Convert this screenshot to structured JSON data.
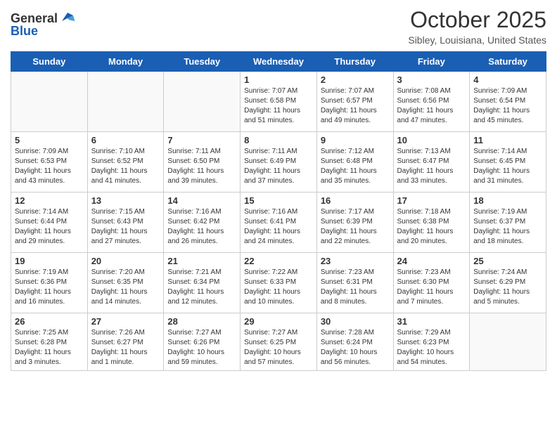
{
  "header": {
    "logo_general": "General",
    "logo_blue": "Blue",
    "month_title": "October 2025",
    "location": "Sibley, Louisiana, United States"
  },
  "days_of_week": [
    "Sunday",
    "Monday",
    "Tuesday",
    "Wednesday",
    "Thursday",
    "Friday",
    "Saturday"
  ],
  "weeks": [
    [
      {
        "day": "",
        "info": ""
      },
      {
        "day": "",
        "info": ""
      },
      {
        "day": "",
        "info": ""
      },
      {
        "day": "1",
        "info": "Sunrise: 7:07 AM\nSunset: 6:58 PM\nDaylight: 11 hours and 51 minutes."
      },
      {
        "day": "2",
        "info": "Sunrise: 7:07 AM\nSunset: 6:57 PM\nDaylight: 11 hours and 49 minutes."
      },
      {
        "day": "3",
        "info": "Sunrise: 7:08 AM\nSunset: 6:56 PM\nDaylight: 11 hours and 47 minutes."
      },
      {
        "day": "4",
        "info": "Sunrise: 7:09 AM\nSunset: 6:54 PM\nDaylight: 11 hours and 45 minutes."
      }
    ],
    [
      {
        "day": "5",
        "info": "Sunrise: 7:09 AM\nSunset: 6:53 PM\nDaylight: 11 hours and 43 minutes."
      },
      {
        "day": "6",
        "info": "Sunrise: 7:10 AM\nSunset: 6:52 PM\nDaylight: 11 hours and 41 minutes."
      },
      {
        "day": "7",
        "info": "Sunrise: 7:11 AM\nSunset: 6:50 PM\nDaylight: 11 hours and 39 minutes."
      },
      {
        "day": "8",
        "info": "Sunrise: 7:11 AM\nSunset: 6:49 PM\nDaylight: 11 hours and 37 minutes."
      },
      {
        "day": "9",
        "info": "Sunrise: 7:12 AM\nSunset: 6:48 PM\nDaylight: 11 hours and 35 minutes."
      },
      {
        "day": "10",
        "info": "Sunrise: 7:13 AM\nSunset: 6:47 PM\nDaylight: 11 hours and 33 minutes."
      },
      {
        "day": "11",
        "info": "Sunrise: 7:14 AM\nSunset: 6:45 PM\nDaylight: 11 hours and 31 minutes."
      }
    ],
    [
      {
        "day": "12",
        "info": "Sunrise: 7:14 AM\nSunset: 6:44 PM\nDaylight: 11 hours and 29 minutes."
      },
      {
        "day": "13",
        "info": "Sunrise: 7:15 AM\nSunset: 6:43 PM\nDaylight: 11 hours and 27 minutes."
      },
      {
        "day": "14",
        "info": "Sunrise: 7:16 AM\nSunset: 6:42 PM\nDaylight: 11 hours and 26 minutes."
      },
      {
        "day": "15",
        "info": "Sunrise: 7:16 AM\nSunset: 6:41 PM\nDaylight: 11 hours and 24 minutes."
      },
      {
        "day": "16",
        "info": "Sunrise: 7:17 AM\nSunset: 6:39 PM\nDaylight: 11 hours and 22 minutes."
      },
      {
        "day": "17",
        "info": "Sunrise: 7:18 AM\nSunset: 6:38 PM\nDaylight: 11 hours and 20 minutes."
      },
      {
        "day": "18",
        "info": "Sunrise: 7:19 AM\nSunset: 6:37 PM\nDaylight: 11 hours and 18 minutes."
      }
    ],
    [
      {
        "day": "19",
        "info": "Sunrise: 7:19 AM\nSunset: 6:36 PM\nDaylight: 11 hours and 16 minutes."
      },
      {
        "day": "20",
        "info": "Sunrise: 7:20 AM\nSunset: 6:35 PM\nDaylight: 11 hours and 14 minutes."
      },
      {
        "day": "21",
        "info": "Sunrise: 7:21 AM\nSunset: 6:34 PM\nDaylight: 11 hours and 12 minutes."
      },
      {
        "day": "22",
        "info": "Sunrise: 7:22 AM\nSunset: 6:33 PM\nDaylight: 11 hours and 10 minutes."
      },
      {
        "day": "23",
        "info": "Sunrise: 7:23 AM\nSunset: 6:31 PM\nDaylight: 11 hours and 8 minutes."
      },
      {
        "day": "24",
        "info": "Sunrise: 7:23 AM\nSunset: 6:30 PM\nDaylight: 11 hours and 7 minutes."
      },
      {
        "day": "25",
        "info": "Sunrise: 7:24 AM\nSunset: 6:29 PM\nDaylight: 11 hours and 5 minutes."
      }
    ],
    [
      {
        "day": "26",
        "info": "Sunrise: 7:25 AM\nSunset: 6:28 PM\nDaylight: 11 hours and 3 minutes."
      },
      {
        "day": "27",
        "info": "Sunrise: 7:26 AM\nSunset: 6:27 PM\nDaylight: 11 hours and 1 minute."
      },
      {
        "day": "28",
        "info": "Sunrise: 7:27 AM\nSunset: 6:26 PM\nDaylight: 10 hours and 59 minutes."
      },
      {
        "day": "29",
        "info": "Sunrise: 7:27 AM\nSunset: 6:25 PM\nDaylight: 10 hours and 57 minutes."
      },
      {
        "day": "30",
        "info": "Sunrise: 7:28 AM\nSunset: 6:24 PM\nDaylight: 10 hours and 56 minutes."
      },
      {
        "day": "31",
        "info": "Sunrise: 7:29 AM\nSunset: 6:23 PM\nDaylight: 10 hours and 54 minutes."
      },
      {
        "day": "",
        "info": ""
      }
    ]
  ]
}
